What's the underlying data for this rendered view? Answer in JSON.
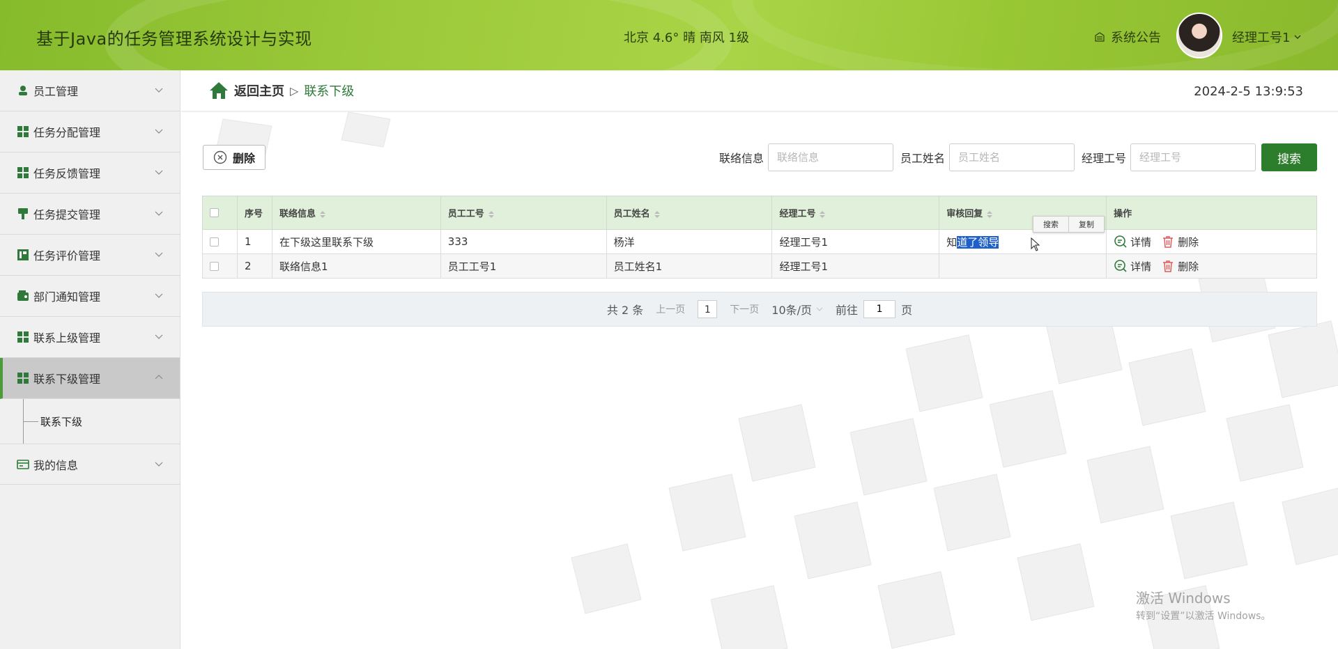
{
  "header": {
    "title": "基于Java的任务管理系统设计与实现",
    "weather": "北京 4.6° 晴 南风 1级",
    "notice": "系统公告",
    "user": "经理工号1"
  },
  "sidebar": {
    "items": [
      {
        "label": "员工管理",
        "icon": "user-icon"
      },
      {
        "label": "任务分配管理",
        "icon": "grid-icon"
      },
      {
        "label": "任务反馈管理",
        "icon": "grid-icon"
      },
      {
        "label": "任务提交管理",
        "icon": "brush-icon"
      },
      {
        "label": "任务评价管理",
        "icon": "chart-icon"
      },
      {
        "label": "部门通知管理",
        "icon": "wallet-icon"
      },
      {
        "label": "联系上级管理",
        "icon": "grid-icon"
      },
      {
        "label": "联系下级管理",
        "icon": "grid-icon"
      }
    ],
    "subitem": "联系下级",
    "last_item": "我的信息"
  },
  "breadcrumb": {
    "home": "返回主页",
    "sep": "▷",
    "current": "联系下级"
  },
  "datetime": "2024-2-5 13:9:53",
  "toolbar": {
    "delete": "删除"
  },
  "search": {
    "label1": "联络信息",
    "ph1": "联络信息",
    "label2": "员工姓名",
    "ph2": "员工姓名",
    "label3": "经理工号",
    "ph3": "经理工号",
    "button": "搜索"
  },
  "table": {
    "headers": [
      "序号",
      "联络信息",
      "员工工号",
      "员工姓名",
      "经理工号",
      "审核回复",
      "操作"
    ],
    "rows": [
      {
        "no": "1",
        "info": "在下级这里联系下级",
        "emp_id": "333",
        "emp_name": "杨洋",
        "mgr_id": "经理工号1",
        "reply_a": "知",
        "reply_b": "道了领导"
      },
      {
        "no": "2",
        "info": "联络信息1",
        "emp_id": "员工工号1",
        "emp_name": "员工姓名1",
        "mgr_id": "经理工号1",
        "reply_a": "",
        "reply_b": ""
      }
    ],
    "op_detail": "详情",
    "op_delete": "删除"
  },
  "context_menu": [
    "搜索",
    "复制"
  ],
  "pager": {
    "total": "共 2 条",
    "prev": "上一页",
    "page": "1",
    "next": "下一页",
    "size": "10条/页",
    "goto_label": "前往",
    "goto_value": "1",
    "goto_unit": "页"
  },
  "watermark": {
    "line1": "激活 Windows",
    "line2": "转到“设置”以激活 Windows。"
  },
  "colors": {
    "header": "#9fcc3c",
    "accent": "#2c7d2c",
    "table_header": "#e1f0da",
    "selection": "#1f5fc9"
  }
}
